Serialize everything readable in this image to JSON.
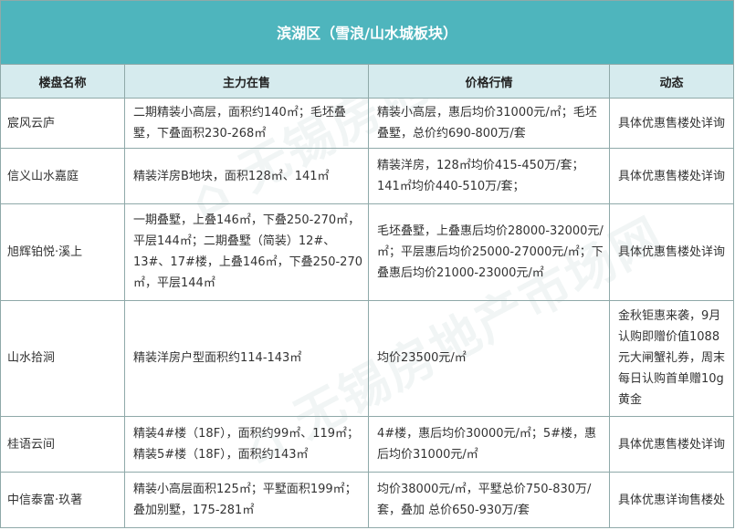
{
  "title": "滨湖区（雪浪/山水城板块）",
  "headers": [
    "楼盘名称",
    "主力在售",
    "价格行情",
    "动态"
  ],
  "rows": [
    {
      "name": "宸风云庐",
      "main": "二期精装小高层，面积约140㎡；毛坯叠墅，下叠面积230-268㎡",
      "price": "精装小高层，惠后均价31000元/㎡；毛坯叠墅，总价约690-800万/套",
      "dynamic": "具体优惠售楼处详询"
    },
    {
      "name": "信义山水嘉庭",
      "main": "精装洋房B地块，面积128㎡、141㎡",
      "price": "精装洋房，128㎡均价415-450万/套；141㎡均价440-510万/套；",
      "dynamic": "具体优惠售楼处详询"
    },
    {
      "name": "旭辉铂悦·溪上",
      "main": "一期叠墅，上叠146㎡，下叠250-270㎡，平层144㎡；二期叠墅（简装）12#、13#、17#楼，上叠146㎡，下叠250-270㎡，平层144㎡",
      "price": "毛坯叠墅，上叠惠后均价28000-32000元/㎡；平层惠后均价25000-27000元/㎡；下叠惠后均价21000-23000元/㎡",
      "dynamic": "具体优惠售楼处详询"
    },
    {
      "name": "山水拾涧",
      "main": "精装洋房户型面积约114-143㎡",
      "price": "均价23500元/㎡",
      "dynamic": "金秋钜惠来袭，9月认购即赠价值1088元大闸蟹礼券，周末每日认购首单赠10g黄金"
    },
    {
      "name": "桂语云间",
      "main": "精装4#楼（18F），面积约99㎡、119㎡；精装5#楼（18F），面积约143㎡",
      "price": "4#楼，惠后均价30000元/㎡；5#楼，惠后均价31000元/㎡",
      "dynamic": "具体优惠售楼处详询"
    },
    {
      "name": "中信泰富·玖著",
      "main": "精装小高层面积125㎡；平墅面积199㎡；叠加别墅，175-281㎡",
      "price": "均价38000元/㎡，平墅总价750-830万/套，叠加 总价650-930万/套",
      "dynamic": "具体优惠详询售楼处"
    }
  ]
}
